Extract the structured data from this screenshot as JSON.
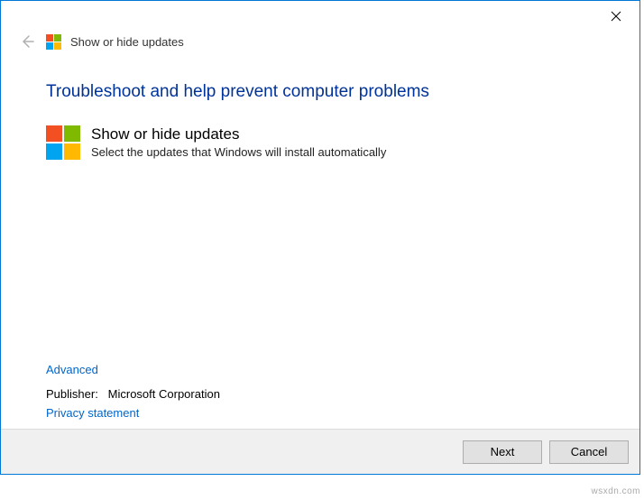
{
  "header": {
    "title": "Show or hide updates"
  },
  "main": {
    "heading": "Troubleshoot and help prevent computer problems",
    "item": {
      "title": "Show or hide updates",
      "description": "Select the updates that Windows will install automatically"
    },
    "advanced_link": "Advanced",
    "publisher_label": "Publisher:",
    "publisher_value": "Microsoft Corporation",
    "privacy_link": "Privacy statement"
  },
  "buttons": {
    "next": "Next",
    "cancel": "Cancel"
  },
  "watermark": "wsxdn.com"
}
